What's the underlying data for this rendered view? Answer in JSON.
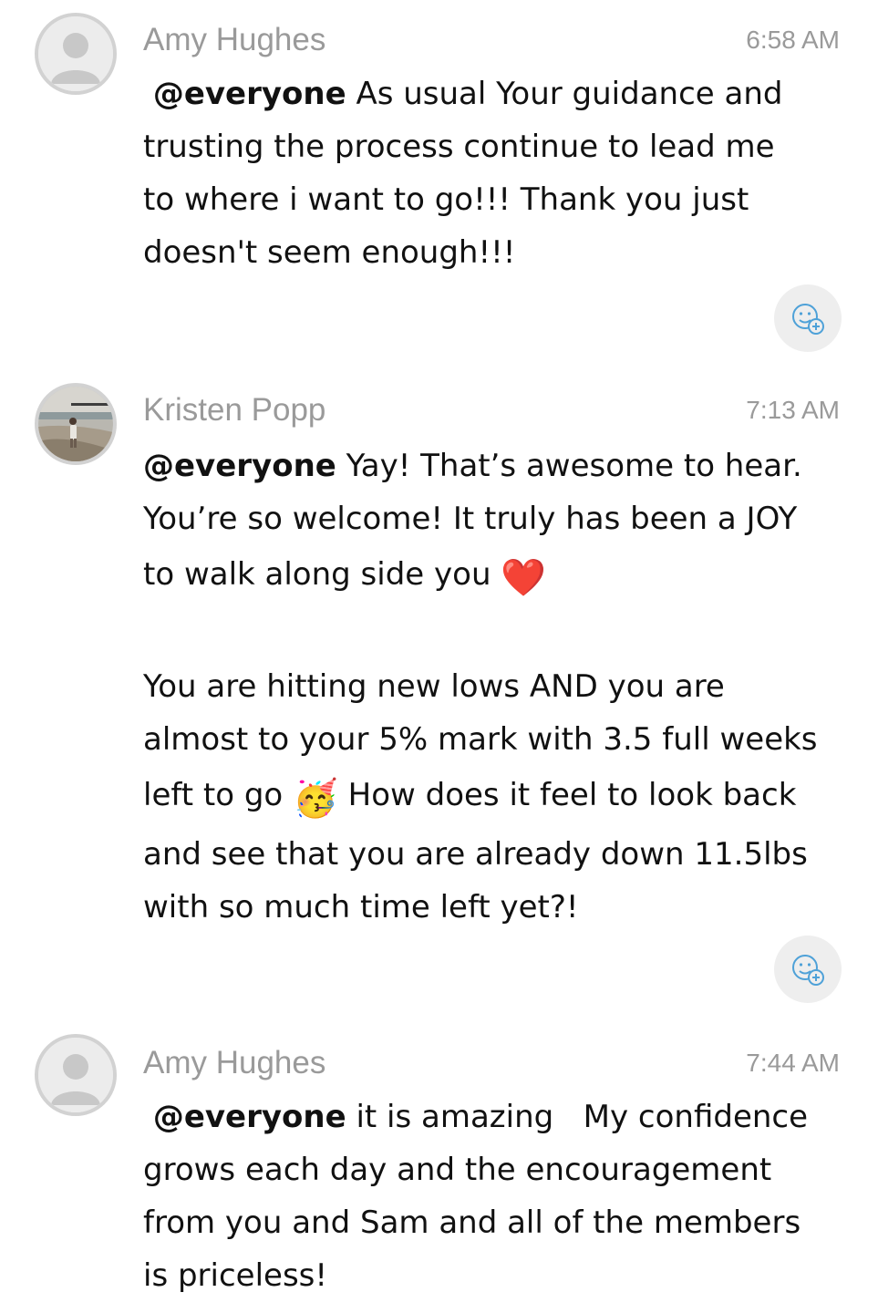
{
  "messages": [
    {
      "author": "Amy Hughes",
      "time": "6:58 AM",
      "mention": "@everyone",
      "lines": [
        "As usual Your guidance and",
        "trusting the process continue to lead me",
        "to where i want to go!!! Thank you just",
        "doesn't seem enough!!!"
      ],
      "avatar": "default-avatar"
    },
    {
      "author": "Kristen Popp",
      "time": "7:13 AM",
      "mention": "@everyone",
      "lines": [
        "Yay! That’s awesome to hear.",
        "You’re so welcome! It truly has been a JOY",
        "to walk along side you",
        "",
        "You are hitting new lows AND you are",
        "almost to your 5% mark with 3.5 full weeks",
        "left to go",
        "How does it feel to look back",
        "and see that you are already down 11.5lbs",
        "with so much time left yet?!"
      ],
      "emoji_heart": "❤️",
      "emoji_party": "🥳",
      "avatar": "photo-avatar"
    },
    {
      "author": "Amy Hughes",
      "time": "7:44 AM",
      "mention": "@everyone",
      "lines": [
        "it is amazing   My confidence",
        "grows each day and the encouragement",
        "from you and Sam and all of the members",
        "is priceless!"
      ],
      "avatar": "default-avatar"
    }
  ],
  "icons": {
    "reaction": "add-reaction-icon"
  },
  "colors": {
    "name": "#9a9a9a",
    "time": "#9a9a9a",
    "text": "#111111",
    "reaction_bg": "#eeeeee",
    "reaction_icon": "#4ea1d8"
  }
}
